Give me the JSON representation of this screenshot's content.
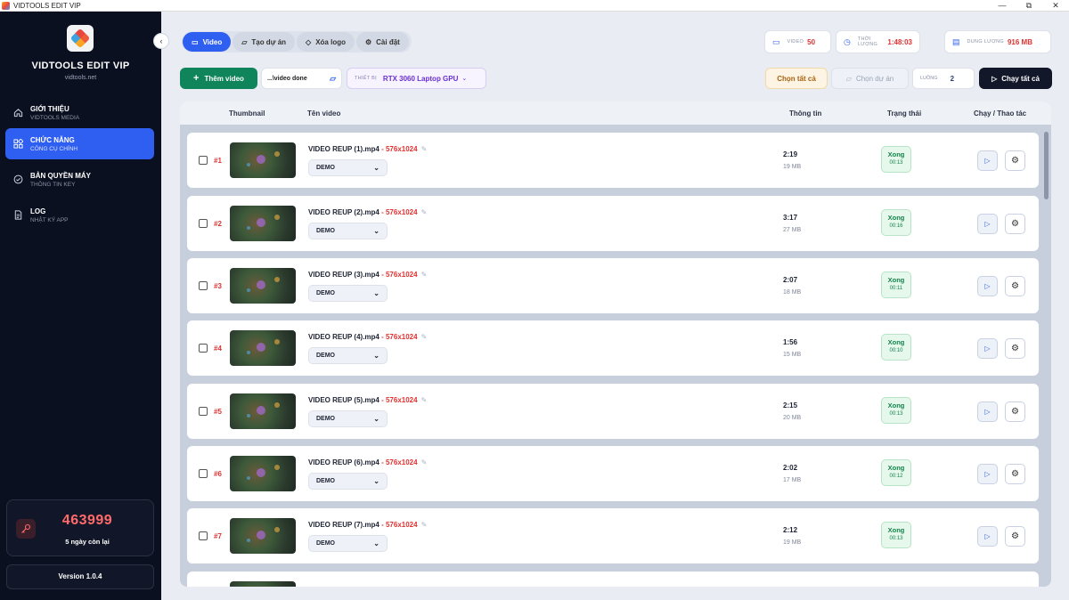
{
  "window": {
    "title": "VIDTOOLS EDIT VIP",
    "minimize": "—",
    "maximize": "⧉",
    "close": "✕"
  },
  "sidebar": {
    "brand": "VIDTOOLS EDIT VIP",
    "website": "vidtools.net",
    "items": [
      {
        "title": "GIỚI THIỆU",
        "subtitle": "VIDTOOLS MEDIA",
        "icon": "home-icon",
        "active": false
      },
      {
        "title": "CHỨC NĂNG",
        "subtitle": "CÔNG CỤ CHÍNH",
        "icon": "grid-icon",
        "active": true
      },
      {
        "title": "BẢN QUYỀN MÁY",
        "subtitle": "THÔNG TIN KEY",
        "icon": "check-circle-icon",
        "active": false
      },
      {
        "title": "LOG",
        "subtitle": "NHẬT KÝ APP",
        "icon": "document-icon",
        "active": false
      }
    ],
    "license_code": "463999",
    "days_left": "5 ngày còn lại",
    "version": "Version 1.0.4"
  },
  "tabs": [
    {
      "label": "Video",
      "icon": "video-icon",
      "active": true
    },
    {
      "label": "Tạo dự án",
      "icon": "folder-icon",
      "active": false
    },
    {
      "label": "Xóa logo",
      "icon": "eraser-icon",
      "active": false
    },
    {
      "label": "Cài đặt",
      "icon": "gear-icon",
      "active": false
    }
  ],
  "stats": {
    "video_label": "VIDEO",
    "video_value": "50",
    "duration_label": "THỜI LƯỢNG",
    "duration_value": "1:48:03",
    "storage_label": "DUNG LƯỢNG",
    "storage_value": "916 MB"
  },
  "toolbar": {
    "add_video": "Thêm video",
    "folder": "...\\video done",
    "device_label": "THIẾT BỊ",
    "device_value": "RTX 3060 Laptop GPU",
    "select_all": "Chọn tất cả",
    "select_project": "Chọn dự án",
    "threads_label": "LUỒNG",
    "threads_value": "2",
    "run_all": "Chạy tất cả"
  },
  "table": {
    "columns": {
      "thumbnail": "Thumbnail",
      "name": "Tên video",
      "info": "Thông tin",
      "status": "Trạng thái",
      "actions": "Chạy / Thao tác"
    },
    "rows": [
      {
        "index": "#1",
        "name": "VIDEO REUP (1).mp4",
        "resolution": " - 576x1024",
        "preset": "DEMO",
        "duration": "2:19",
        "size": "19 MB",
        "status": "Xong",
        "elapsed": "00:13"
      },
      {
        "index": "#2",
        "name": "VIDEO REUP (2).mp4",
        "resolution": " - 576x1024",
        "preset": "DEMO",
        "duration": "3:17",
        "size": "27 MB",
        "status": "Xong",
        "elapsed": "00:16"
      },
      {
        "index": "#3",
        "name": "VIDEO REUP (3).mp4",
        "resolution": " - 576x1024",
        "preset": "DEMO",
        "duration": "2:07",
        "size": "18 MB",
        "status": "Xong",
        "elapsed": "00:11"
      },
      {
        "index": "#4",
        "name": "VIDEO REUP (4).mp4",
        "resolution": " - 576x1024",
        "preset": "DEMO",
        "duration": "1:56",
        "size": "15 MB",
        "status": "Xong",
        "elapsed": "00:10"
      },
      {
        "index": "#5",
        "name": "VIDEO REUP (5).mp4",
        "resolution": " - 576x1024",
        "preset": "DEMO",
        "duration": "2:15",
        "size": "20 MB",
        "status": "Xong",
        "elapsed": "00:13"
      },
      {
        "index": "#6",
        "name": "VIDEO REUP (6).mp4",
        "resolution": " - 576x1024",
        "preset": "DEMO",
        "duration": "2:02",
        "size": "17 MB",
        "status": "Xong",
        "elapsed": "00:12"
      },
      {
        "index": "#7",
        "name": "VIDEO REUP (7).mp4",
        "resolution": " - 576x1024",
        "preset": "DEMO",
        "duration": "2:12",
        "size": "19 MB",
        "status": "Xong",
        "elapsed": "00:13"
      }
    ]
  },
  "colors": {
    "accent": "#2f5ff0",
    "success": "#12834b",
    "danger": "#e03131",
    "sidebar_bg": "#0b1020"
  }
}
